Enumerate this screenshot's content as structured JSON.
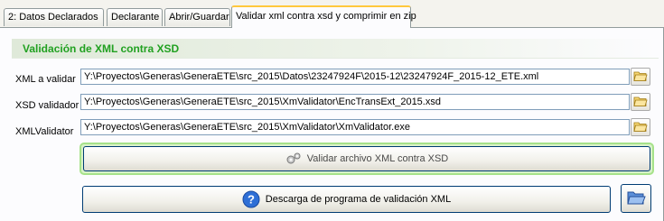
{
  "tabs": [
    {
      "label": "2: Datos Declarados",
      "active": false
    },
    {
      "label": "Declarante",
      "active": false
    },
    {
      "label": "Abrir/Guardar",
      "active": false
    },
    {
      "label": "Validar xml contra xsd y comprimir en zip",
      "active": true
    }
  ],
  "section": {
    "title": "Validación de XML contra XSD",
    "title_color": "#21a121"
  },
  "fields": [
    {
      "label": "XML a validar",
      "value": "Y:\\Proyectos\\Generas\\GeneraETE\\src_2015\\Datos\\23247924F\\2015-12\\23247924F_2015-12_ETE.xml",
      "icon": "folder-open-icon"
    },
    {
      "label": "XSD validador",
      "value": "Y:\\Proyectos\\Generas\\GeneraETE\\src_2015\\XmValidator\\EncTransExt_2015.xsd",
      "icon": "folder-open-icon"
    },
    {
      "label": "XMLValidator",
      "value": "Y:\\Proyectos\\Generas\\GeneraETE\\src_2015\\XmValidator\\XmValidator.exe",
      "icon": "folder-open-icon"
    }
  ],
  "buttons": {
    "validate": {
      "label": "Validar archivo XML contra XSD",
      "icon": "gears-icon"
    },
    "download": {
      "label": "Descarga de programa de validación XML",
      "icon": "help-icon"
    },
    "side": {
      "icon": "folder-open-icon"
    }
  }
}
